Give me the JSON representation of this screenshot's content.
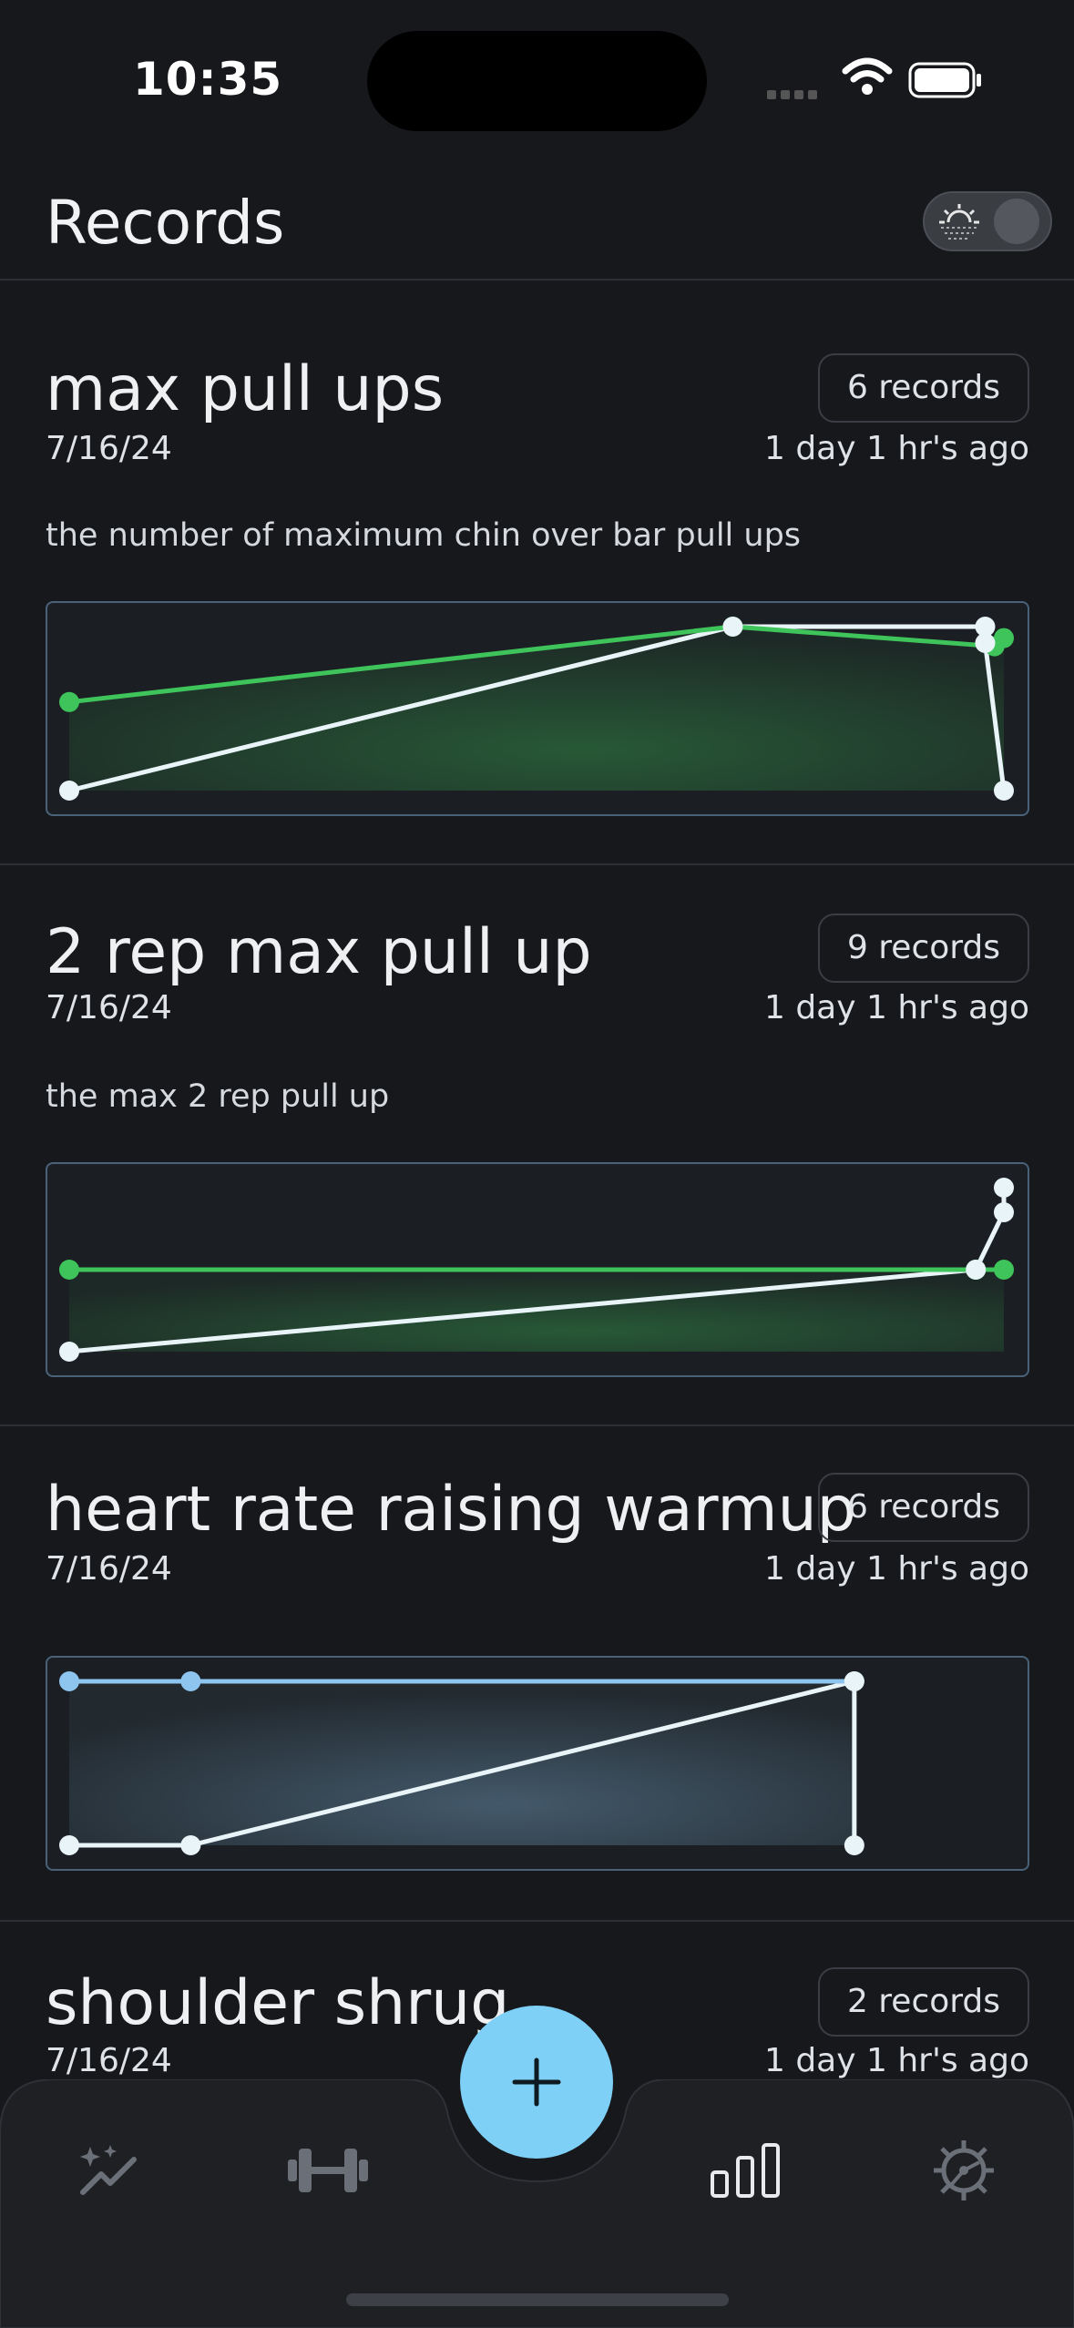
{
  "status_bar": {
    "time": "10:35"
  },
  "header": {
    "title": "Records"
  },
  "records": [
    {
      "name": "max pull ups",
      "badge": "6 records",
      "date": "7/16/24",
      "ago": "1 day 1 hr's ago",
      "description": "the number of maximum chin over bar pull ups",
      "accent": "#3ec45a"
    },
    {
      "name": "2 rep max pull up",
      "badge": "9 records",
      "date": "7/16/24",
      "ago": "1 day 1 hr's ago",
      "description": "the max 2 rep pull up",
      "accent": "#3ec45a"
    },
    {
      "name": "heart rate raising warmup",
      "badge": "6 records",
      "date": "7/16/24",
      "ago": "1 day 1 hr's ago",
      "description": "",
      "accent": "#8ec5ee"
    },
    {
      "name": "shoulder shrug",
      "badge": "2 records",
      "date": "7/16/24",
      "ago": "1 day 1 hr's ago",
      "description": ""
    }
  ],
  "chart_data": [
    {
      "type": "line",
      "series": [
        {
          "color": "#3ec45a",
          "x": [
            0,
            0.71,
            0.99,
            1.0
          ],
          "y": [
            0.54,
            1.0,
            0.88,
            0.93
          ]
        },
        {
          "color": "#e8f4f8",
          "x": [
            0,
            0.71,
            0.98,
            0.98,
            1.0
          ],
          "y": [
            0.0,
            1.0,
            1.0,
            0.9,
            0.0
          ]
        }
      ],
      "ylim": [
        0,
        1
      ]
    },
    {
      "type": "line",
      "series": [
        {
          "color": "#3ec45a",
          "x": [
            0,
            0.97,
            0.97,
            1.0
          ],
          "y": [
            0.5,
            0.5,
            0.5,
            0.5
          ]
        },
        {
          "color": "#e8f4f8",
          "x": [
            0,
            0.97,
            1.0,
            1.0
          ],
          "y": [
            0.0,
            0.5,
            0.85,
            1.0
          ]
        }
      ],
      "ylim": [
        0,
        1
      ]
    },
    {
      "type": "line",
      "series": [
        {
          "color": "#8ec5ee",
          "x": [
            0,
            0.13,
            0.84
          ],
          "y": [
            1.0,
            1.0,
            1.0
          ]
        },
        {
          "color": "#e8f4f8",
          "x": [
            0,
            0.13,
            0.84,
            0.84
          ],
          "y": [
            0.0,
            0.0,
            1.0,
            0.0
          ]
        }
      ],
      "ylim": [
        0,
        1
      ]
    }
  ],
  "tab_bar": {
    "items": [
      {
        "icon": "trend-sparkle-icon"
      },
      {
        "icon": "dumbbell-icon"
      },
      {
        "icon": "plus-icon"
      },
      {
        "icon": "bar-chart-icon"
      },
      {
        "icon": "settings-icon"
      }
    ]
  }
}
